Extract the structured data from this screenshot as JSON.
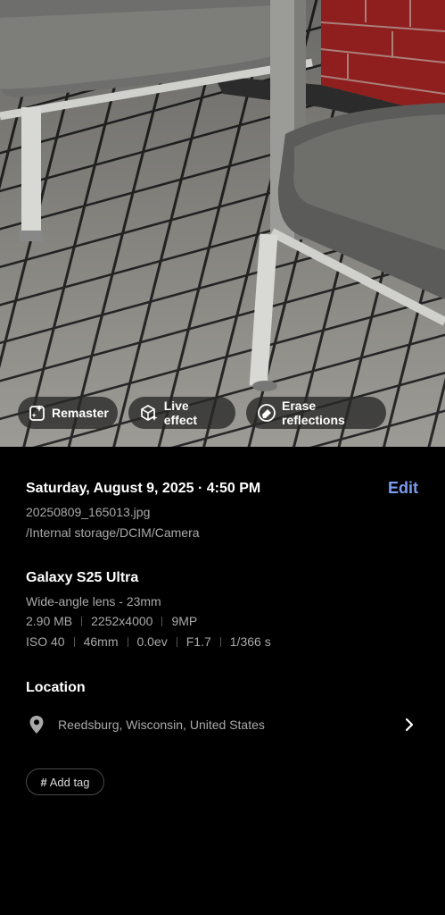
{
  "photo_actions": [
    {
      "label": "Remaster",
      "icon": "sparkle-frame-icon"
    },
    {
      "label": "Live effect",
      "icon": "cube-sparkle-icon"
    },
    {
      "label": "Erase reflections",
      "icon": "eraser-icon"
    }
  ],
  "details": {
    "datetime": "Saturday, August 9, 2025 · 4:50 PM",
    "edit_label": "Edit",
    "filename": "20250809_165013.jpg",
    "path": "/Internal storage/DCIM/Camera"
  },
  "camera": {
    "device": "Galaxy S25 Ultra",
    "lens": "Wide-angle lens - 23mm",
    "file_stats": [
      "2.90 MB",
      "2252x4000",
      "9MP"
    ],
    "exposure": [
      "ISO 40",
      "46mm",
      "0.0ev",
      "F1.7",
      "1/366 s"
    ]
  },
  "location": {
    "heading": "Location",
    "place": "Reedsburg, Wisconsin, United States"
  },
  "tags": {
    "add_label": "Add tag",
    "hash": "#"
  },
  "colors": {
    "accent": "#7c9cf0",
    "background": "#000000",
    "secondary_text": "#a9a9a9"
  }
}
